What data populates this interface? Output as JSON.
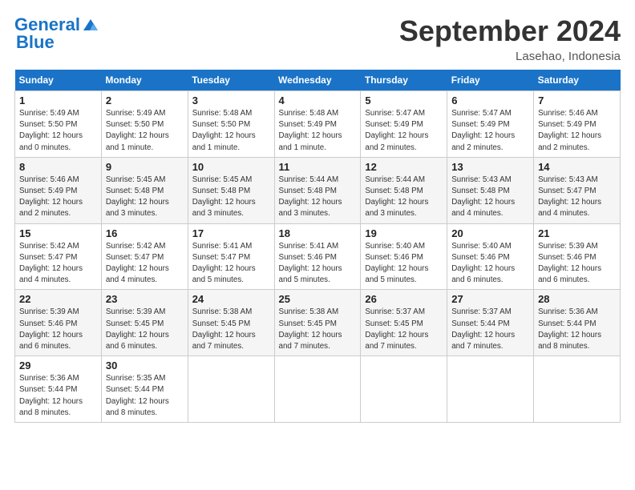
{
  "logo": {
    "part1": "General",
    "part2": "Blue"
  },
  "title": "September 2024",
  "location": "Lasehao, Indonesia",
  "days_of_week": [
    "Sunday",
    "Monday",
    "Tuesday",
    "Wednesday",
    "Thursday",
    "Friday",
    "Saturday"
  ],
  "weeks": [
    [
      {
        "day": "1",
        "info": "Sunrise: 5:49 AM\nSunset: 5:50 PM\nDaylight: 12 hours\nand 0 minutes."
      },
      {
        "day": "2",
        "info": "Sunrise: 5:49 AM\nSunset: 5:50 PM\nDaylight: 12 hours\nand 1 minute."
      },
      {
        "day": "3",
        "info": "Sunrise: 5:48 AM\nSunset: 5:50 PM\nDaylight: 12 hours\nand 1 minute."
      },
      {
        "day": "4",
        "info": "Sunrise: 5:48 AM\nSunset: 5:49 PM\nDaylight: 12 hours\nand 1 minute."
      },
      {
        "day": "5",
        "info": "Sunrise: 5:47 AM\nSunset: 5:49 PM\nDaylight: 12 hours\nand 2 minutes."
      },
      {
        "day": "6",
        "info": "Sunrise: 5:47 AM\nSunset: 5:49 PM\nDaylight: 12 hours\nand 2 minutes."
      },
      {
        "day": "7",
        "info": "Sunrise: 5:46 AM\nSunset: 5:49 PM\nDaylight: 12 hours\nand 2 minutes."
      }
    ],
    [
      {
        "day": "8",
        "info": "Sunrise: 5:46 AM\nSunset: 5:49 PM\nDaylight: 12 hours\nand 2 minutes."
      },
      {
        "day": "9",
        "info": "Sunrise: 5:45 AM\nSunset: 5:48 PM\nDaylight: 12 hours\nand 3 minutes."
      },
      {
        "day": "10",
        "info": "Sunrise: 5:45 AM\nSunset: 5:48 PM\nDaylight: 12 hours\nand 3 minutes."
      },
      {
        "day": "11",
        "info": "Sunrise: 5:44 AM\nSunset: 5:48 PM\nDaylight: 12 hours\nand 3 minutes."
      },
      {
        "day": "12",
        "info": "Sunrise: 5:44 AM\nSunset: 5:48 PM\nDaylight: 12 hours\nand 3 minutes."
      },
      {
        "day": "13",
        "info": "Sunrise: 5:43 AM\nSunset: 5:48 PM\nDaylight: 12 hours\nand 4 minutes."
      },
      {
        "day": "14",
        "info": "Sunrise: 5:43 AM\nSunset: 5:47 PM\nDaylight: 12 hours\nand 4 minutes."
      }
    ],
    [
      {
        "day": "15",
        "info": "Sunrise: 5:42 AM\nSunset: 5:47 PM\nDaylight: 12 hours\nand 4 minutes."
      },
      {
        "day": "16",
        "info": "Sunrise: 5:42 AM\nSunset: 5:47 PM\nDaylight: 12 hours\nand 4 minutes."
      },
      {
        "day": "17",
        "info": "Sunrise: 5:41 AM\nSunset: 5:47 PM\nDaylight: 12 hours\nand 5 minutes."
      },
      {
        "day": "18",
        "info": "Sunrise: 5:41 AM\nSunset: 5:46 PM\nDaylight: 12 hours\nand 5 minutes."
      },
      {
        "day": "19",
        "info": "Sunrise: 5:40 AM\nSunset: 5:46 PM\nDaylight: 12 hours\nand 5 minutes."
      },
      {
        "day": "20",
        "info": "Sunrise: 5:40 AM\nSunset: 5:46 PM\nDaylight: 12 hours\nand 6 minutes."
      },
      {
        "day": "21",
        "info": "Sunrise: 5:39 AM\nSunset: 5:46 PM\nDaylight: 12 hours\nand 6 minutes."
      }
    ],
    [
      {
        "day": "22",
        "info": "Sunrise: 5:39 AM\nSunset: 5:46 PM\nDaylight: 12 hours\nand 6 minutes."
      },
      {
        "day": "23",
        "info": "Sunrise: 5:39 AM\nSunset: 5:45 PM\nDaylight: 12 hours\nand 6 minutes."
      },
      {
        "day": "24",
        "info": "Sunrise: 5:38 AM\nSunset: 5:45 PM\nDaylight: 12 hours\nand 7 minutes."
      },
      {
        "day": "25",
        "info": "Sunrise: 5:38 AM\nSunset: 5:45 PM\nDaylight: 12 hours\nand 7 minutes."
      },
      {
        "day": "26",
        "info": "Sunrise: 5:37 AM\nSunset: 5:45 PM\nDaylight: 12 hours\nand 7 minutes."
      },
      {
        "day": "27",
        "info": "Sunrise: 5:37 AM\nSunset: 5:44 PM\nDaylight: 12 hours\nand 7 minutes."
      },
      {
        "day": "28",
        "info": "Sunrise: 5:36 AM\nSunset: 5:44 PM\nDaylight: 12 hours\nand 8 minutes."
      }
    ],
    [
      {
        "day": "29",
        "info": "Sunrise: 5:36 AM\nSunset: 5:44 PM\nDaylight: 12 hours\nand 8 minutes."
      },
      {
        "day": "30",
        "info": "Sunrise: 5:35 AM\nSunset: 5:44 PM\nDaylight: 12 hours\nand 8 minutes."
      },
      {
        "day": "",
        "info": ""
      },
      {
        "day": "",
        "info": ""
      },
      {
        "day": "",
        "info": ""
      },
      {
        "day": "",
        "info": ""
      },
      {
        "day": "",
        "info": ""
      }
    ]
  ]
}
